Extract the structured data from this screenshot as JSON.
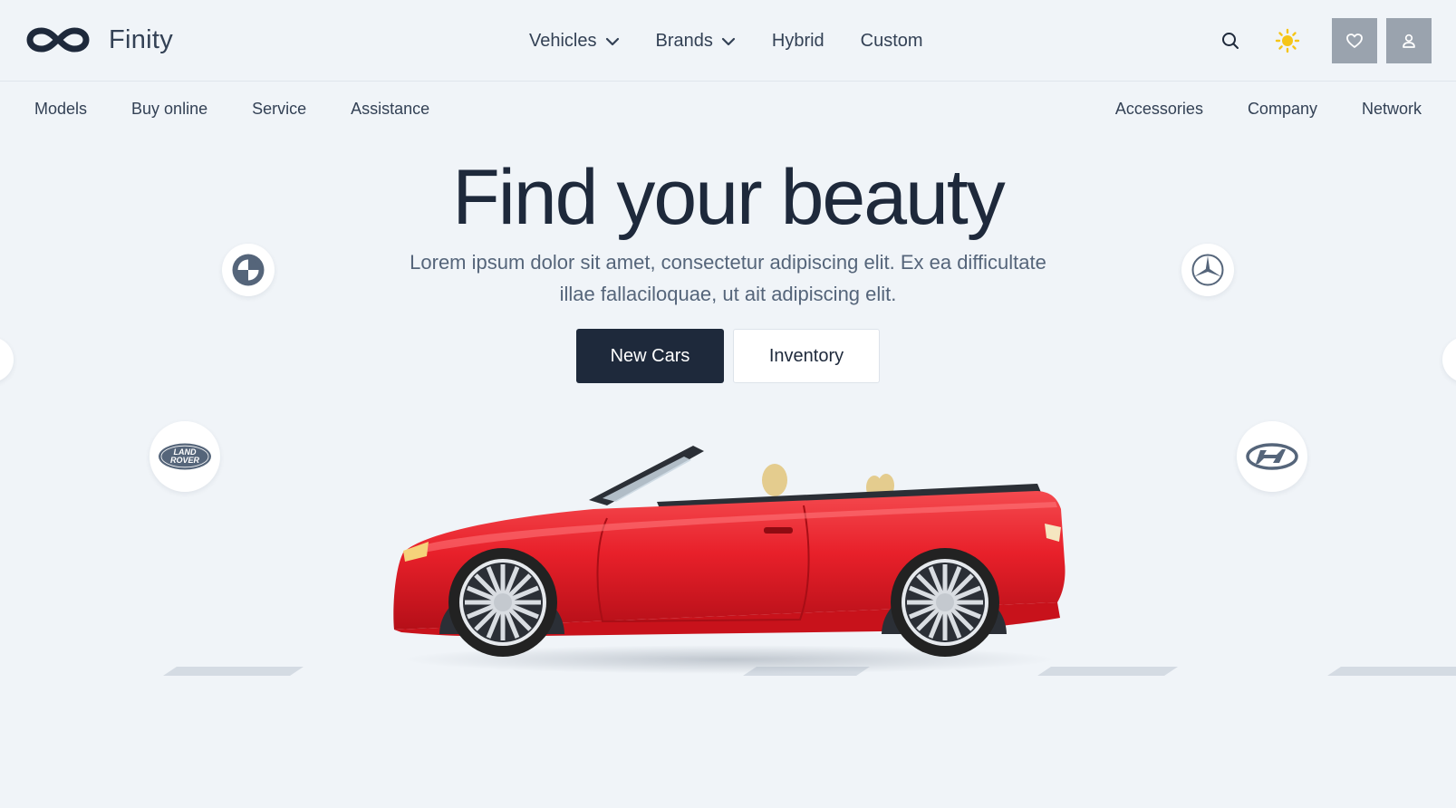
{
  "brand": {
    "name": "Finity",
    "logo_icon": "infinity-logo-icon"
  },
  "main_nav": [
    {
      "label": "Vehicles",
      "has_dropdown": true
    },
    {
      "label": "Brands",
      "has_dropdown": true
    },
    {
      "label": "Hybrid",
      "has_dropdown": false
    },
    {
      "label": "Custom",
      "has_dropdown": false
    }
  ],
  "actions": {
    "search_icon": "search-icon",
    "theme_icon": "sun-icon",
    "favorites_icon": "heart-icon",
    "account_icon": "user-icon"
  },
  "subnav_left": [
    "Models",
    "Buy online",
    "Service",
    "Assistance"
  ],
  "subnav_right": [
    "Accessories",
    "Company",
    "Network"
  ],
  "hero": {
    "title": "Find your beauty",
    "description": "Lorem ipsum dolor sit amet, consectetur adipiscing elit. Ex ea difficultate illae fallaciloquae, ut ait adipiscing elit.",
    "primary_button": "New Cars",
    "secondary_button": "Inventory"
  },
  "brand_badges": [
    {
      "brand": "BMW",
      "icon": "bmw-logo-icon"
    },
    {
      "brand": "Mercedes-Benz",
      "icon": "mercedes-logo-icon"
    },
    {
      "brand": "Land Rover",
      "icon": "land-rover-logo-icon",
      "text_line1": "LAND",
      "text_line2": "ROVER"
    },
    {
      "brand": "Hyundai",
      "icon": "hyundai-logo-icon"
    }
  ],
  "colors": {
    "background": "#f0f4f8",
    "text_dark": "#1e293b",
    "primary_button": "#1e293b",
    "icon_button": "#9aa3ae",
    "sun": "#f5c518",
    "car": "#e8202a"
  }
}
